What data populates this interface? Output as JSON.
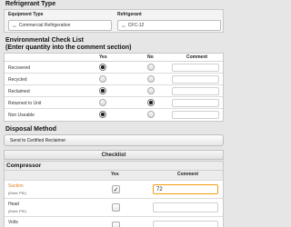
{
  "refrigerant_type": {
    "title": "Refrigerant Type",
    "equipment_type_label": "Equipment Type",
    "refrigerant_label": "Refrigerant",
    "equipment_type_value": "Commercial Refrigeration",
    "refrigerant_value": "CFC-12"
  },
  "env_checklist": {
    "title_line1": "Environmental Check List",
    "title_line2": "(Enter quantity into the comment section)",
    "col_yes": "Yes",
    "col_no": "No",
    "col_comment": "Comment",
    "rows": [
      {
        "label": "Recovered",
        "selected": "yes"
      },
      {
        "label": "Recycled",
        "selected": "none"
      },
      {
        "label": "Reclaimed",
        "selected": "yes"
      },
      {
        "label": "Returned to Unit",
        "selected": "no"
      },
      {
        "label": "Non Useable",
        "selected": "yes"
      }
    ]
  },
  "disposal": {
    "title": "Disposal Method",
    "value": "Send to Certified Reclaimer"
  },
  "checklist_tab": "Checklist",
  "compressor": {
    "title": "Compressor",
    "col_yes": "Yes",
    "col_comment": "Comment",
    "items": [
      {
        "label": "Suction",
        "sub": "(Enter PSI)",
        "checked": true,
        "value": "72",
        "highlight": true
      },
      {
        "label": "Head",
        "sub": "(Enter PSI)",
        "checked": false,
        "value": "",
        "highlight": false
      },
      {
        "label": "Volts",
        "sub": "",
        "checked": false,
        "value": "",
        "highlight": false
      }
    ]
  }
}
